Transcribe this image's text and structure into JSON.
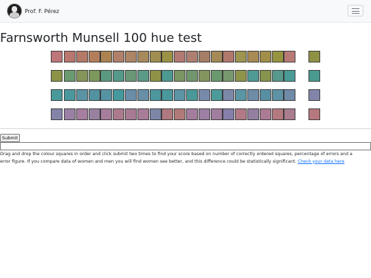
{
  "navbar": {
    "brand_name": "Prof. F. Pérez",
    "logo_icon": "portrait-logo-icon",
    "menu_icon": "hamburger-menu-icon"
  },
  "page": {
    "title": "Farnsworth Munsell 100 hue test"
  },
  "test": {
    "rows": [
      {
        "start_anchor": "#bd767a",
        "colors": [
          "#b9776f",
          "#b57a67",
          "#b37e5b",
          "#ac8350",
          "#b0806a",
          "#ac8566",
          "#a68a5b",
          "#9f8e4f",
          "#9c9245",
          "#b27a72",
          "#ad7f70",
          "#a57e66",
          "#a48a56",
          "#b0786c",
          "#9d9450",
          "#a88a54",
          "#a18e49",
          "#96943f",
          "#b97a75"
        ],
        "end_anchor": "#8e9145"
      },
      {
        "start_anchor": "#8c9347",
        "colors": [
          "#6b9a71",
          "#84955a",
          "#7d985c",
          "#5a9a7f",
          "#55998a",
          "#6a9877",
          "#5a9a86",
          "#8e9348",
          "#4d9a93",
          "#7b9662",
          "#72976f",
          "#83955f",
          "#6b996f",
          "#78986d",
          "#8d944a",
          "#4f9a95",
          "#86944e",
          "#58998d",
          "#4a9a96"
        ],
        "end_anchor": "#4b9a90"
      },
      {
        "start_anchor": "#4a999a",
        "colors": [
          "#4a989d",
          "#5a94a4",
          "#5392a0",
          "#5693a2",
          "#45989c",
          "#6a8ea8",
          "#688fa6",
          "#4d969e",
          "#4a979c",
          "#5c93a5",
          "#4a9898",
          "#778aa9",
          "#4d9a9a",
          "#7c88a8",
          "#5995a3",
          "#6f8ca7",
          "#598fa3",
          "#5e92a5",
          "#708ba8"
        ],
        "end_anchor": "#8284a9"
      },
      {
        "start_anchor": "#8483a8",
        "colors": [
          "#9a80a5",
          "#a57ea0",
          "#98819f",
          "#a67e9b",
          "#ab7b8d",
          "#a87b93",
          "#a97c98",
          "#7d86a7",
          "#b0797f",
          "#b17a78",
          "#a47d9c",
          "#9c7fa2",
          "#a17e9f",
          "#857fa9",
          "#b27a86",
          "#947fa1",
          "#ab7b95",
          "#b3797f",
          "#a97c8f"
        ],
        "end_anchor": "#b5787e"
      }
    ],
    "submit_label": "Submit",
    "result_value": ""
  },
  "instructions": {
    "text": "Drag and drop the colour squares in order and click submit two times to find your score based on number of correctly ordered squares, percentage of errors and a error figure. If you compare data of women and men you will find women see better, and this difference could be statistically significant. ",
    "link_text": "Check your data here",
    "link_color": "#0d6efd"
  }
}
